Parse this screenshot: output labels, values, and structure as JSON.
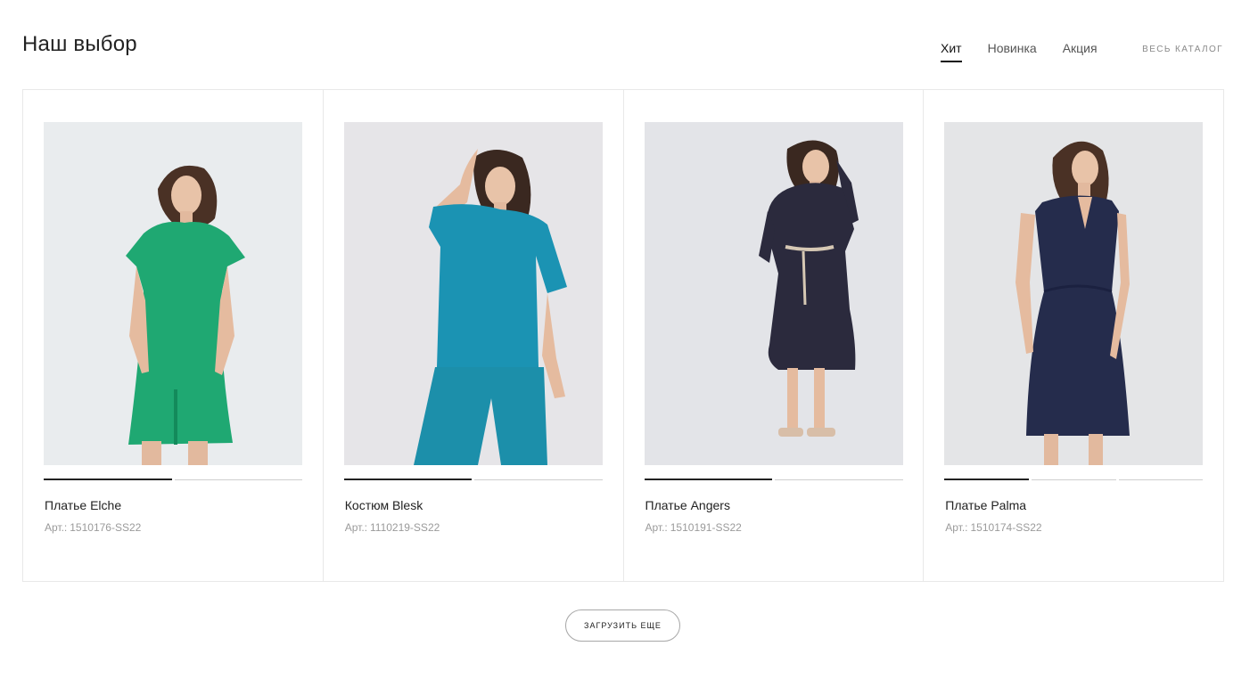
{
  "section": {
    "title": "Наш выбор"
  },
  "tabs": [
    {
      "label": "Хит",
      "active": true
    },
    {
      "label": "Новинка",
      "active": false
    },
    {
      "label": "Акция",
      "active": false
    }
  ],
  "catalog_link": "ВЕСЬ КАТАЛОГ",
  "sku_label": "Арт.:",
  "products": [
    {
      "name": "Платье Elche",
      "sku": "1510176-SS22",
      "garment_color": "#1fa872",
      "photo_count": 2,
      "active_photo": 1
    },
    {
      "name": "Костюм Blesk",
      "sku": "1110219-SS22",
      "garment_color": "#1b93b3",
      "photo_count": 2,
      "active_photo": 1
    },
    {
      "name": "Платье Angers",
      "sku": "1510191-SS22",
      "garment_color": "#2b2a3d",
      "photo_count": 2,
      "active_photo": 1
    },
    {
      "name": "Платье Palma",
      "sku": "1510174-SS22",
      "garment_color": "#252c4c",
      "photo_count": 3,
      "active_photo": 1
    }
  ],
  "load_more": "ЗАГРУЗИТЬ ЕЩЕ",
  "colors": {
    "text": "#222222",
    "muted": "#9a9a9a",
    "border": "#e8e8e8"
  }
}
